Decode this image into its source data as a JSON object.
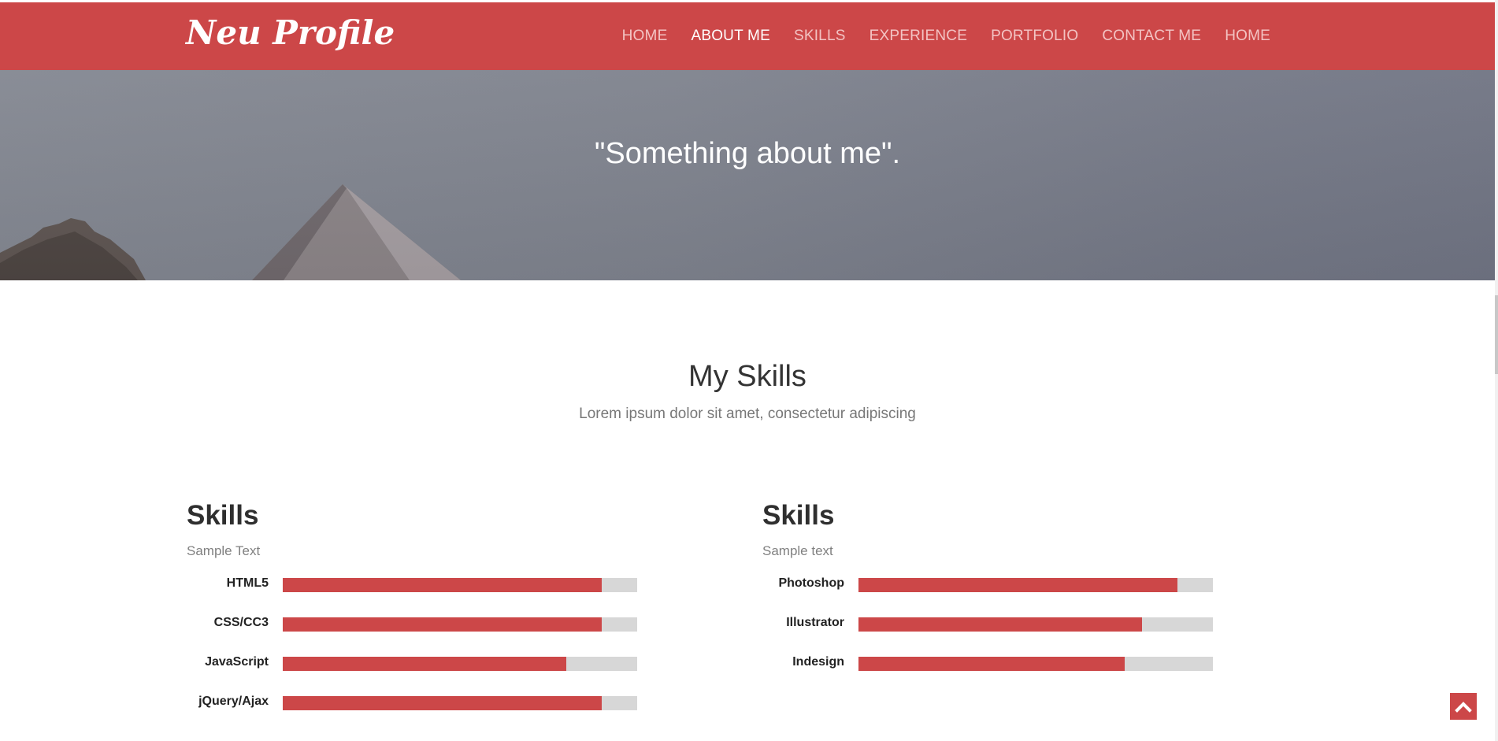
{
  "brand": {
    "name": "Neu Profile"
  },
  "nav": {
    "items": [
      {
        "label": "HOME",
        "active": false
      },
      {
        "label": "ABOUT ME",
        "active": true
      },
      {
        "label": "SKILLS",
        "active": false
      },
      {
        "label": "EXPERIENCE",
        "active": false
      },
      {
        "label": "PORTFOLIO",
        "active": false
      },
      {
        "label": "CONTACT ME",
        "active": false
      },
      {
        "label": "HOME",
        "active": false
      }
    ]
  },
  "hero": {
    "quote": "\"Something about me\"."
  },
  "section": {
    "title": "My Skills",
    "subtitle": "Lorem ipsum dolor sit amet, consectetur adipiscing"
  },
  "columns": [
    {
      "title": "Skills",
      "subtitle": "Sample Text",
      "skills": [
        {
          "name": "HTML5",
          "level": 0.9
        },
        {
          "name": "CSS/CC3",
          "level": 0.9
        },
        {
          "name": "JavaScript",
          "level": 0.8
        },
        {
          "name": "jQuery/Ajax",
          "level": 0.9
        }
      ]
    },
    {
      "title": "Skills",
      "subtitle": "Sample text",
      "skills": [
        {
          "name": "Photoshop",
          "level": 0.9
        },
        {
          "name": "Illustrator",
          "level": 0.8
        },
        {
          "name": "Indesign",
          "level": 0.75
        }
      ]
    }
  ],
  "colors": {
    "accent": "#cc4748",
    "track": "#d7d7d7"
  },
  "icons": {
    "scroll_top": "chevron-up-icon"
  }
}
